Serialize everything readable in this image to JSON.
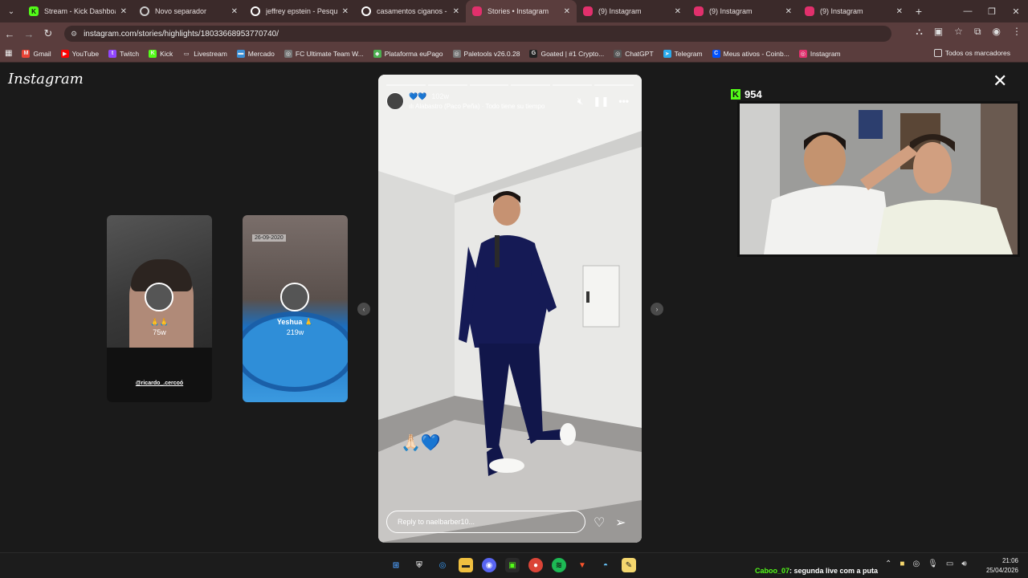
{
  "browser": {
    "tabs": [
      {
        "title": "Stream - Kick Dashboard",
        "icon": "K",
        "color": "#53fc18",
        "active": false
      },
      {
        "title": "Novo separador",
        "icon": "chrome-icon",
        "color": "#cccccc",
        "active": false
      },
      {
        "title": "jeffrey epstein - Pesquisa",
        "icon": "google-icon",
        "color": "#ffffff",
        "active": false
      },
      {
        "title": "casamentos ciganos - Pes",
        "icon": "google-icon",
        "color": "#ffffff",
        "active": false
      },
      {
        "title": "Stories • Instagram",
        "icon": "instagram-icon",
        "color": "#e1306c",
        "active": true
      },
      {
        "title": "(9) Instagram",
        "icon": "instagram-icon",
        "color": "#e1306c",
        "active": false
      },
      {
        "title": "(9) Instagram",
        "icon": "instagram-icon",
        "color": "#e1306c",
        "active": false
      },
      {
        "title": "(9) Instagram",
        "icon": "instagram-icon",
        "color": "#e1306c",
        "active": false
      }
    ],
    "url": "instagram.com/stories/highlights/18033668953770740/",
    "bookmarks": [
      {
        "label": "Gmail",
        "icon": "M",
        "color": "#ea4335"
      },
      {
        "label": "YouTube",
        "icon": "▶",
        "color": "#ff0000"
      },
      {
        "label": "Twitch",
        "icon": "t",
        "color": "#9146ff"
      },
      {
        "label": "Kick",
        "icon": "K",
        "color": "#53fc18"
      },
      {
        "label": "Livestream",
        "icon": "▭",
        "color": "#5a3d3d"
      },
      {
        "label": "Mercado",
        "icon": "▬",
        "color": "#3a8fd6"
      },
      {
        "label": "FC Ultimate Team W...",
        "icon": "◎",
        "color": "#777777"
      },
      {
        "label": "Plataforma euPago",
        "icon": "◆",
        "color": "#4caf50"
      },
      {
        "label": "Paletools v26.0.28",
        "icon": "◎",
        "color": "#777777"
      },
      {
        "label": "Goated | #1 Crypto...",
        "icon": "G",
        "color": "#222222"
      },
      {
        "label": "ChatGPT",
        "icon": "◎",
        "color": "#555555"
      },
      {
        "label": "Telegram",
        "icon": "➤",
        "color": "#2aabee"
      },
      {
        "label": "Meus ativos - Coinb...",
        "icon": "C",
        "color": "#0052ff"
      },
      {
        "label": "Instagram",
        "icon": "◎",
        "color": "#e1306c"
      }
    ],
    "bookmarks_all": "Todos os marcadores"
  },
  "instagram": {
    "logo": "Instagram",
    "side_stories": [
      {
        "name": "🙏🙏",
        "age": "75w",
        "caption": "@ricardo_.cercoó",
        "date": ""
      },
      {
        "name": "Yeshua 🙏",
        "age": "219w",
        "caption": "",
        "date": "26-09-2020"
      }
    ],
    "story": {
      "username": "💙💙",
      "age": "102w",
      "music": "Alabastro (Paco Peña) · Todo tiene su tiempo",
      "emoji": "🙏🏻💙",
      "reply_placeholder": "Reply to naelbarber10...",
      "progress_total": 6,
      "progress_done": 0
    }
  },
  "overlay": {
    "kick_viewers": "954"
  },
  "taskbar": {
    "chat_user": "Caboo_07",
    "chat_message": ": segunda live com a puta",
    "time": "21:06",
    "date": "25/04/2026"
  }
}
